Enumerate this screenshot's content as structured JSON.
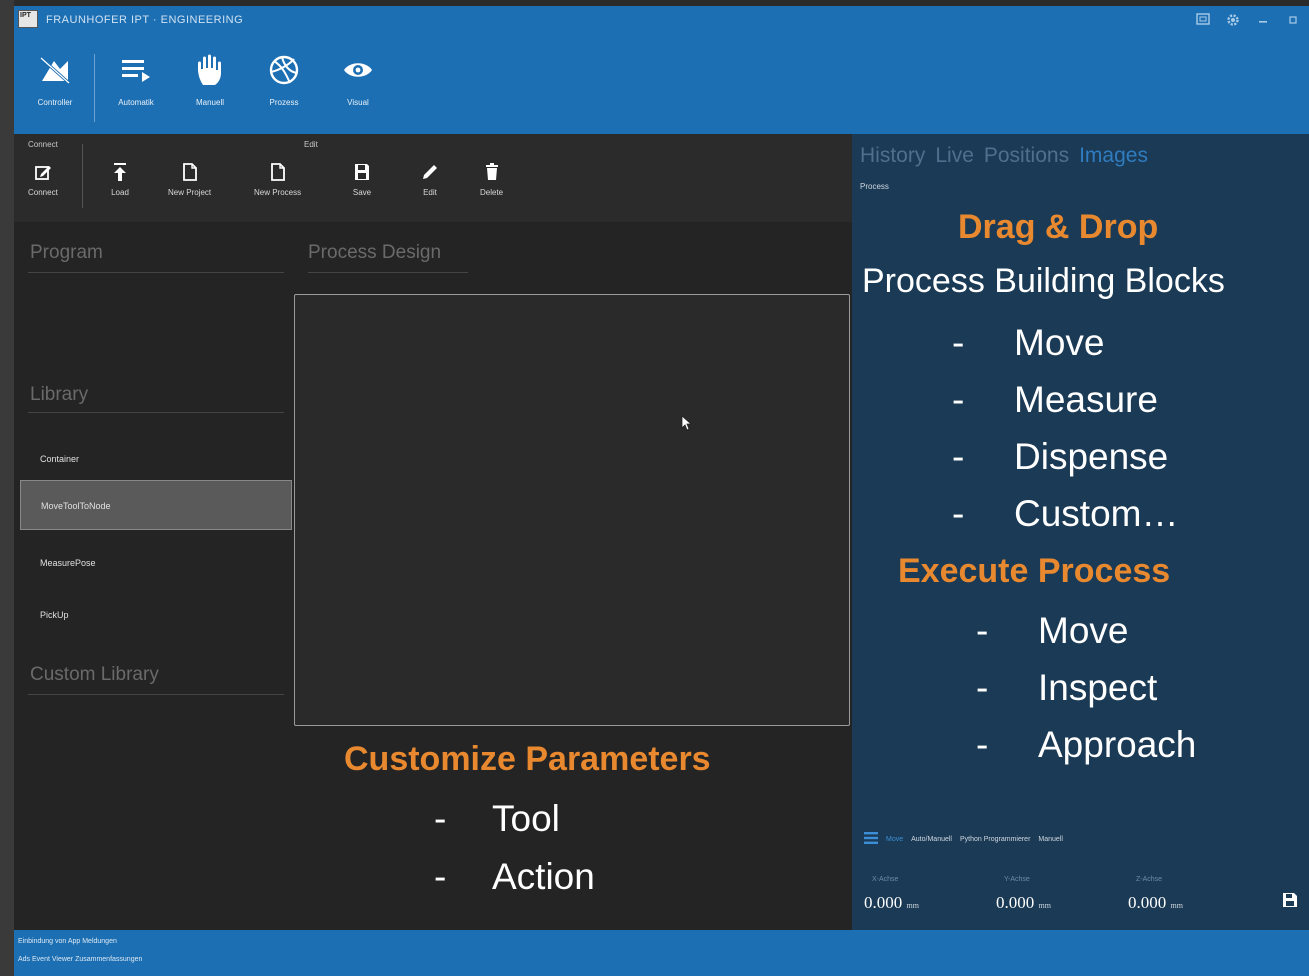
{
  "window": {
    "title": "FRAUNHOFER IPT · ENGINEERING",
    "logo_text": "IPT"
  },
  "main_nav": [
    {
      "label": "Controller",
      "icon": "controller-icon"
    },
    {
      "label": "Automatik",
      "icon": "list-play-icon"
    },
    {
      "label": "Manuell",
      "icon": "hand-icon"
    },
    {
      "label": "Prozess",
      "icon": "ball-icon"
    },
    {
      "label": "Visual",
      "icon": "eye-icon"
    }
  ],
  "toolbar": {
    "group_connect": "Connect",
    "group_edit": "Edit",
    "connect": "Connect",
    "load": "Load",
    "new_project": "New Project",
    "new_process": "New Process",
    "save": "Save",
    "edit": "Edit",
    "delete": "Delete"
  },
  "left": {
    "program_title": "Program",
    "process_design_title": "Process Design",
    "library_title": "Library",
    "library_items": [
      "Container",
      "MoveToolToNode",
      "MeasurePose",
      "PickUp"
    ],
    "selected_index": 1,
    "custom_library_title": "Custom Library"
  },
  "annotations": {
    "customize_title": "Customize Parameters",
    "customize_items": [
      "Tool",
      "Action"
    ],
    "dragdrop_title": "Drag & Drop",
    "dragdrop_subtitle": "Process Building Blocks",
    "dragdrop_items": [
      "Move",
      "Measure",
      "Dispense",
      "Custom…"
    ],
    "execute_title": "Execute Process",
    "execute_items": [
      "Move",
      "Inspect",
      "Approach"
    ],
    "dash": "-"
  },
  "right": {
    "tabs": [
      "History",
      "Live",
      "Positions",
      "Images"
    ],
    "active_tab": 3,
    "subtitle": "Process",
    "modes": [
      "Move",
      "Auto/Manuell",
      "Python Programmierer",
      "Manuell"
    ],
    "active_mode": 0,
    "axes": [
      {
        "label": "X-Achse",
        "value": "0.000",
        "unit": "mm"
      },
      {
        "label": "Y-Achse",
        "value": "0.000",
        "unit": "mm"
      },
      {
        "label": "Z-Achse",
        "value": "0.000",
        "unit": "mm"
      }
    ]
  },
  "status": {
    "line1": "Einbindung von App Meldungen",
    "line2": "Ads Event Viewer Zusammenfassungen"
  },
  "colors": {
    "ribbon": "#1d6fb3",
    "accent_orange": "#e9892f",
    "right_panel": "#1b3a55"
  }
}
